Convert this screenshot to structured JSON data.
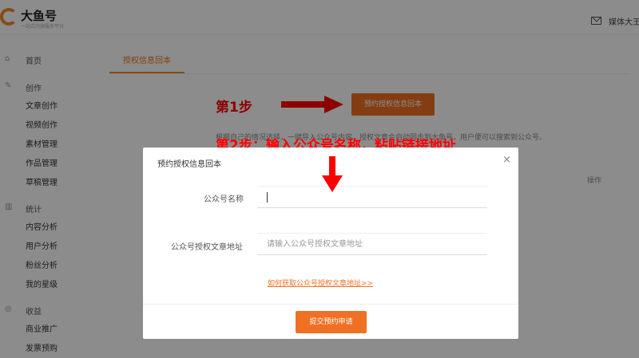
{
  "header": {
    "logo_title": "大鱼号",
    "logo_subtitle": "一站式内容服务平台",
    "user_label": "媒体大王"
  },
  "sidebar": {
    "groups": [
      {
        "icon": "home-icon",
        "label": "首页",
        "items": []
      },
      {
        "icon": "pen-icon",
        "label": "创作",
        "items": [
          "文章创作",
          "视频创作",
          "素材管理",
          "作品管理",
          "草稿管理"
        ]
      },
      {
        "icon": "chart-icon",
        "label": "统计",
        "items": [
          "内容分析",
          "用户分析",
          "粉丝分析",
          "我的星级"
        ]
      },
      {
        "icon": "coin-icon",
        "label": "收益",
        "items": [
          "商业推广",
          "发票预购"
        ]
      }
    ]
  },
  "main": {
    "tab_label": "授权信息回本",
    "description": "根据自己的情况选择，一键导入公众号内容，授权文章会自动同步到大鱼号，用户便可以搜索到公众号。",
    "column_header": "操作",
    "top_button": "预约授权信息回本"
  },
  "annotations": {
    "step1": "第1步",
    "step2": "第2步：输入公众号名称，粘贴链接地址"
  },
  "modal": {
    "title": "预约授权信息回本",
    "close": "×",
    "fields": [
      {
        "label": "公众号名称",
        "value": "",
        "placeholder": ""
      },
      {
        "label": "公众号授权文章地址",
        "value": "",
        "placeholder": "请输入公众号授权文章地址"
      }
    ],
    "help_link": "如何获取公众号授权文章地址>>",
    "submit": "提交预约申请"
  },
  "colors": {
    "accent": "#f07024",
    "annotation": "#ff0000"
  }
}
